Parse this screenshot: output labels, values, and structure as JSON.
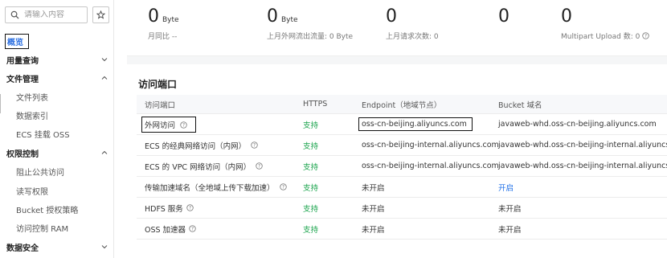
{
  "sidebar": {
    "search_placeholder": "请输入内容",
    "items": [
      {
        "label": "概览",
        "type": "active"
      },
      {
        "label": "用量查询",
        "type": "group",
        "chevron": "down"
      },
      {
        "label": "文件管理",
        "type": "group",
        "chevron": "up"
      },
      {
        "label": "文件列表",
        "type": "sub"
      },
      {
        "label": "数据索引",
        "type": "sub"
      },
      {
        "label": "ECS 挂载 OSS",
        "type": "sub"
      },
      {
        "label": "权限控制",
        "type": "group",
        "chevron": "up"
      },
      {
        "label": "阻止公共访问",
        "type": "sub"
      },
      {
        "label": "读写权限",
        "type": "sub"
      },
      {
        "label": "Bucket 授权策略",
        "type": "sub"
      },
      {
        "label": "访问控制 RAM",
        "type": "sub"
      },
      {
        "label": "数据安全",
        "type": "group",
        "chevron": "down"
      }
    ]
  },
  "stats": [
    {
      "value": "0",
      "unit": "Byte",
      "sub": "月同比 --"
    },
    {
      "value": "0",
      "unit": "Byte",
      "sub": "上月外网流出流量: 0 Byte"
    },
    {
      "value": "0",
      "unit": "",
      "sub": "上月请求次数:  0"
    },
    {
      "value": "0",
      "unit": "",
      "sub": ""
    },
    {
      "value": "0",
      "unit": "",
      "sub": "Multipart Upload 数: 0"
    }
  ],
  "ports": {
    "title": "访问端口",
    "headers": [
      "访问端口",
      "HTTPS",
      "Endpoint（地域节点）",
      "Bucket 域名"
    ],
    "rows": [
      {
        "name": "外网访问",
        "https": "支持",
        "endpoint": "oss-cn-beijing.aliyuncs.com",
        "bucket": "javaweb-whd.oss-cn-beijing.aliyuncs.com"
      },
      {
        "name": "ECS 的经典网络访问（内网）",
        "https": "支持",
        "endpoint": "oss-cn-beijing-internal.aliyuncs.com",
        "bucket": "javaweb-whd.oss-cn-beijing-internal.aliyuncs.com"
      },
      {
        "name": "ECS 的 VPC 网络访问（内网）",
        "https": "支持",
        "endpoint": "oss-cn-beijing-internal.aliyuncs.com",
        "bucket": "javaweb-whd.oss-cn-beijing-internal.aliyuncs.com"
      },
      {
        "name": "传输加速域名（全地域上传下载加速）",
        "https": "支持",
        "endpoint": "未开启",
        "bucket": "开启"
      },
      {
        "name": "HDFS 服务",
        "https": "支持",
        "endpoint": "未开启",
        "bucket": "未开启"
      },
      {
        "name": "OSS 加速器",
        "https": "支持",
        "endpoint": "未开启",
        "bucket": "未开启"
      }
    ]
  },
  "colors": {
    "support_green": "#17a34a",
    "link_blue": "#1e6fe8",
    "active_blue": "#2d70e0"
  }
}
